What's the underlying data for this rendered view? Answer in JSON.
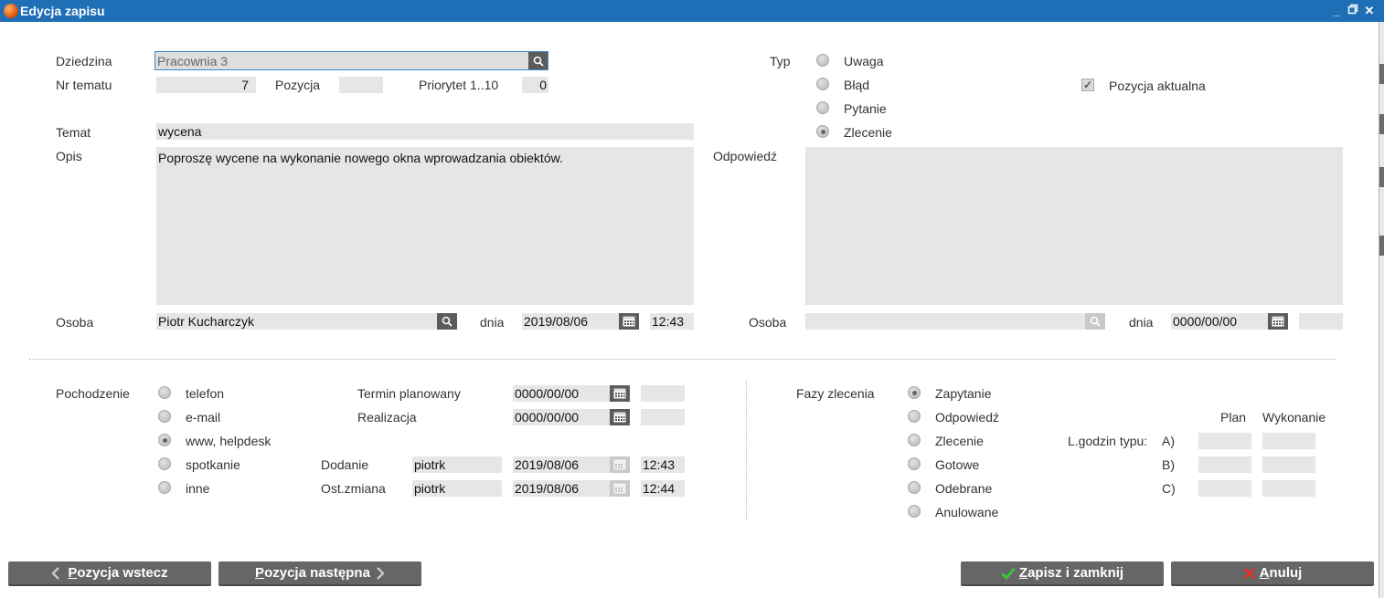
{
  "window": {
    "title": "Edycja zapisu",
    "minimize": "_",
    "restore": "▫",
    "close": "✕"
  },
  "form": {
    "dziedzina": {
      "label": "Dziedzina",
      "value": "Pracownia 3"
    },
    "nr_tematu": {
      "label": "Nr tematu",
      "value": "7"
    },
    "pozycja": {
      "label": "Pozycja",
      "value": ""
    },
    "priorytet": {
      "label": "Priorytet 1..10",
      "value": "0"
    },
    "typ": {
      "label": "Typ",
      "options": [
        "Uwaga",
        "Błąd",
        "Pytanie",
        "Zlecenie"
      ],
      "selected": "Zlecenie"
    },
    "pozycja_aktualna": {
      "label": "Pozycja aktualna",
      "checked": true,
      "mark": "✓"
    },
    "temat": {
      "label": "Temat",
      "value": "wycena"
    },
    "opis": {
      "label": "Opis",
      "value": "Poproszę wycene na wykonanie nowego okna wprowadzania obiektów."
    },
    "odpowiedz": {
      "label": "Odpowiedź",
      "value": ""
    },
    "osoba_left": {
      "label": "Osoba",
      "value": "Piotr Kucharczyk",
      "dnia_label": "dnia",
      "date": "2019/08/06",
      "time": "12:43"
    },
    "osoba_right": {
      "label": "Osoba",
      "value": "",
      "dnia_label": "dnia",
      "date": "0000/00/00",
      "time": ""
    }
  },
  "pochodzenie": {
    "label": "Pochodzenie",
    "options": [
      "telefon",
      "e-mail",
      "www, helpdesk",
      "spotkanie",
      "inne"
    ],
    "selected": "www, helpdesk"
  },
  "terminy": {
    "termin_planowany": {
      "label": "Termin planowany",
      "date": "0000/00/00",
      "time": ""
    },
    "realizacja": {
      "label": "Realizacja",
      "date": "0000/00/00",
      "time": ""
    },
    "dodanie": {
      "label": "Dodanie",
      "user": "piotrk",
      "date": "2019/08/06",
      "time": "12:43"
    },
    "ost_zmiana": {
      "label": "Ost.zmiana",
      "user": "piotrk",
      "date": "2019/08/06",
      "time": "12:44"
    }
  },
  "fazy": {
    "label": "Fazy zlecenia",
    "options": [
      "Zapytanie",
      "Odpowiedź",
      "Zlecenie",
      "Gotowe",
      "Odebrane",
      "Anulowane"
    ],
    "selected": "Zapytanie"
  },
  "godziny": {
    "label": "L.godzin typu:",
    "col_plan": "Plan",
    "col_wykonanie": "Wykonanie",
    "rows": [
      {
        "label": "A)",
        "plan": "",
        "wykonanie": ""
      },
      {
        "label": "B)",
        "plan": "",
        "wykonanie": ""
      },
      {
        "label": "C)",
        "plan": "",
        "wykonanie": ""
      }
    ]
  },
  "buttons": {
    "back": "Pozycja wstecz",
    "next": "Pozycja następna",
    "save": "Zapisz i zamknij",
    "cancel": "Anuluj"
  },
  "colors": {
    "titlebar": "#1e6fb5",
    "button": "#666666",
    "field": "#e6e6e6",
    "save_check": "#3cc43c",
    "cancel_x": "#e0302a"
  }
}
